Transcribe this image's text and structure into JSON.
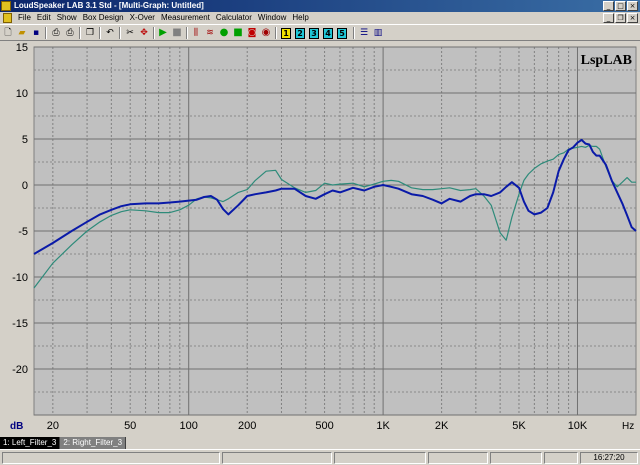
{
  "window": {
    "title": "LoudSpeaker LAB 3.1 Std - [Multi-Graph: Untitled]",
    "controls": [
      "_",
      "□",
      "×"
    ],
    "mdi_controls": [
      "_",
      "❐",
      "×"
    ]
  },
  "menu": [
    "File",
    "Edit",
    "Show",
    "Box Design",
    "X-Over",
    "Measurement",
    "Calculator",
    "Window",
    "Help"
  ],
  "toolbar": {
    "numbered_buttons": [
      "1",
      "2",
      "3",
      "4",
      "5"
    ]
  },
  "graph": {
    "brand": "LspLAB",
    "y_unit": "dB",
    "x_unit": "Hz"
  },
  "tabs": [
    {
      "label": "1: Left_Filter_3",
      "active": true
    },
    {
      "label": "2: Right_Filter_3",
      "active": false
    }
  ],
  "status": {
    "time": "16:27:20"
  },
  "chart_data": {
    "type": "line",
    "x_scale": "log",
    "xlim": [
      16,
      20000
    ],
    "ylim": [
      -25,
      15
    ],
    "grid": true,
    "xtick_labels": [
      {
        "x": 20,
        "label": "20"
      },
      {
        "x": 50,
        "label": "50"
      },
      {
        "x": 100,
        "label": "100"
      },
      {
        "x": 200,
        "label": "200"
      },
      {
        "x": 500,
        "label": "500"
      },
      {
        "x": 1000,
        "label": "1K"
      },
      {
        "x": 2000,
        "label": "2K"
      },
      {
        "x": 5000,
        "label": "5K"
      },
      {
        "x": 10000,
        "label": "10K"
      }
    ],
    "yticks": [
      15,
      10,
      5,
      0,
      -5,
      -10,
      -15,
      -20
    ],
    "series": [
      {
        "name": "Left_Filter_3",
        "color": "#0a1aa8",
        "x": [
          16,
          20,
          25,
          30,
          35,
          40,
          45,
          50,
          60,
          70,
          80,
          90,
          100,
          110,
          120,
          130,
          140,
          150,
          160,
          180,
          200,
          220,
          250,
          280,
          300,
          350,
          400,
          450,
          500,
          550,
          600,
          700,
          800,
          900,
          1000,
          1100,
          1200,
          1400,
          1600,
          1800,
          2000,
          2200,
          2500,
          2800,
          3000,
          3300,
          3600,
          4000,
          4300,
          4600,
          5000,
          5300,
          5600,
          6000,
          6500,
          7000,
          7500,
          8000,
          8500,
          9000,
          9500,
          10000,
          10500,
          11000,
          11500,
          12000,
          12500,
          13000,
          14000,
          15000,
          16000,
          17000,
          18000,
          19000,
          20000
        ],
        "y": [
          -7.5,
          -6.3,
          -5.0,
          -4.0,
          -3.2,
          -2.7,
          -2.3,
          -2.1,
          -2.0,
          -2.0,
          -1.9,
          -1.8,
          -1.7,
          -1.6,
          -1.3,
          -1.2,
          -1.6,
          -2.6,
          -3.2,
          -2.2,
          -1.2,
          -1.0,
          -0.8,
          -0.6,
          -0.4,
          -0.4,
          -1.2,
          -1.5,
          -1.0,
          -0.6,
          -0.8,
          -0.3,
          -0.6,
          -0.2,
          0.0,
          -0.2,
          -0.4,
          -1.0,
          -1.2,
          -1.6,
          -2.0,
          -1.5,
          -1.8,
          -1.2,
          -1.0,
          -1.0,
          -1.2,
          -0.8,
          -0.2,
          0.3,
          -0.3,
          -1.8,
          -2.8,
          -3.2,
          -3.0,
          -2.5,
          -0.8,
          1.5,
          2.8,
          3.8,
          4.1,
          4.6,
          4.9,
          4.5,
          4.4,
          3.6,
          3.2,
          3.2,
          2.2,
          0.5,
          -0.8,
          -2.0,
          -3.3,
          -4.6,
          -5.0
        ]
      },
      {
        "name": "Right_Filter_3",
        "color": "#2e8b7a",
        "x": [
          16,
          20,
          25,
          30,
          35,
          40,
          45,
          50,
          60,
          70,
          80,
          90,
          100,
          110,
          120,
          130,
          140,
          150,
          160,
          180,
          200,
          220,
          250,
          280,
          300,
          350,
          400,
          450,
          500,
          550,
          600,
          700,
          800,
          900,
          1000,
          1100,
          1200,
          1400,
          1600,
          1800,
          2000,
          2200,
          2500,
          2800,
          3000,
          3300,
          3600,
          4000,
          4300,
          4600,
          5000,
          5300,
          5600,
          6000,
          6500,
          7000,
          7500,
          8000,
          8500,
          9000,
          9500,
          10000,
          10500,
          11000,
          11500,
          12000,
          12500,
          13000,
          14000,
          15000,
          16000,
          17000,
          18000,
          19000,
          20000
        ],
        "y": [
          -11.2,
          -8.5,
          -6.5,
          -5.0,
          -4.0,
          -3.3,
          -2.9,
          -2.7,
          -2.8,
          -3.0,
          -3.0,
          -2.7,
          -2.2,
          -1.5,
          -1.3,
          -1.4,
          -1.6,
          -1.8,
          -1.5,
          -0.8,
          -0.5,
          0.5,
          1.5,
          1.6,
          0.6,
          -0.3,
          -0.8,
          -0.6,
          0.2,
          0.0,
          0.1,
          0.2,
          -0.2,
          0.1,
          0.4,
          0.5,
          0.4,
          -0.3,
          -0.5,
          -0.5,
          -0.4,
          -0.3,
          -0.6,
          -0.5,
          -0.4,
          -1.2,
          -2.2,
          -5.2,
          -6.0,
          -3.5,
          -1.0,
          0.5,
          1.2,
          1.8,
          2.3,
          2.6,
          2.8,
          3.3,
          3.5,
          3.9,
          4.0,
          4.1,
          4.2,
          4.1,
          4.3,
          4.2,
          4.2,
          3.9,
          2.0,
          0.5,
          -0.2,
          0.3,
          0.8,
          0.3,
          0.3
        ]
      }
    ]
  }
}
